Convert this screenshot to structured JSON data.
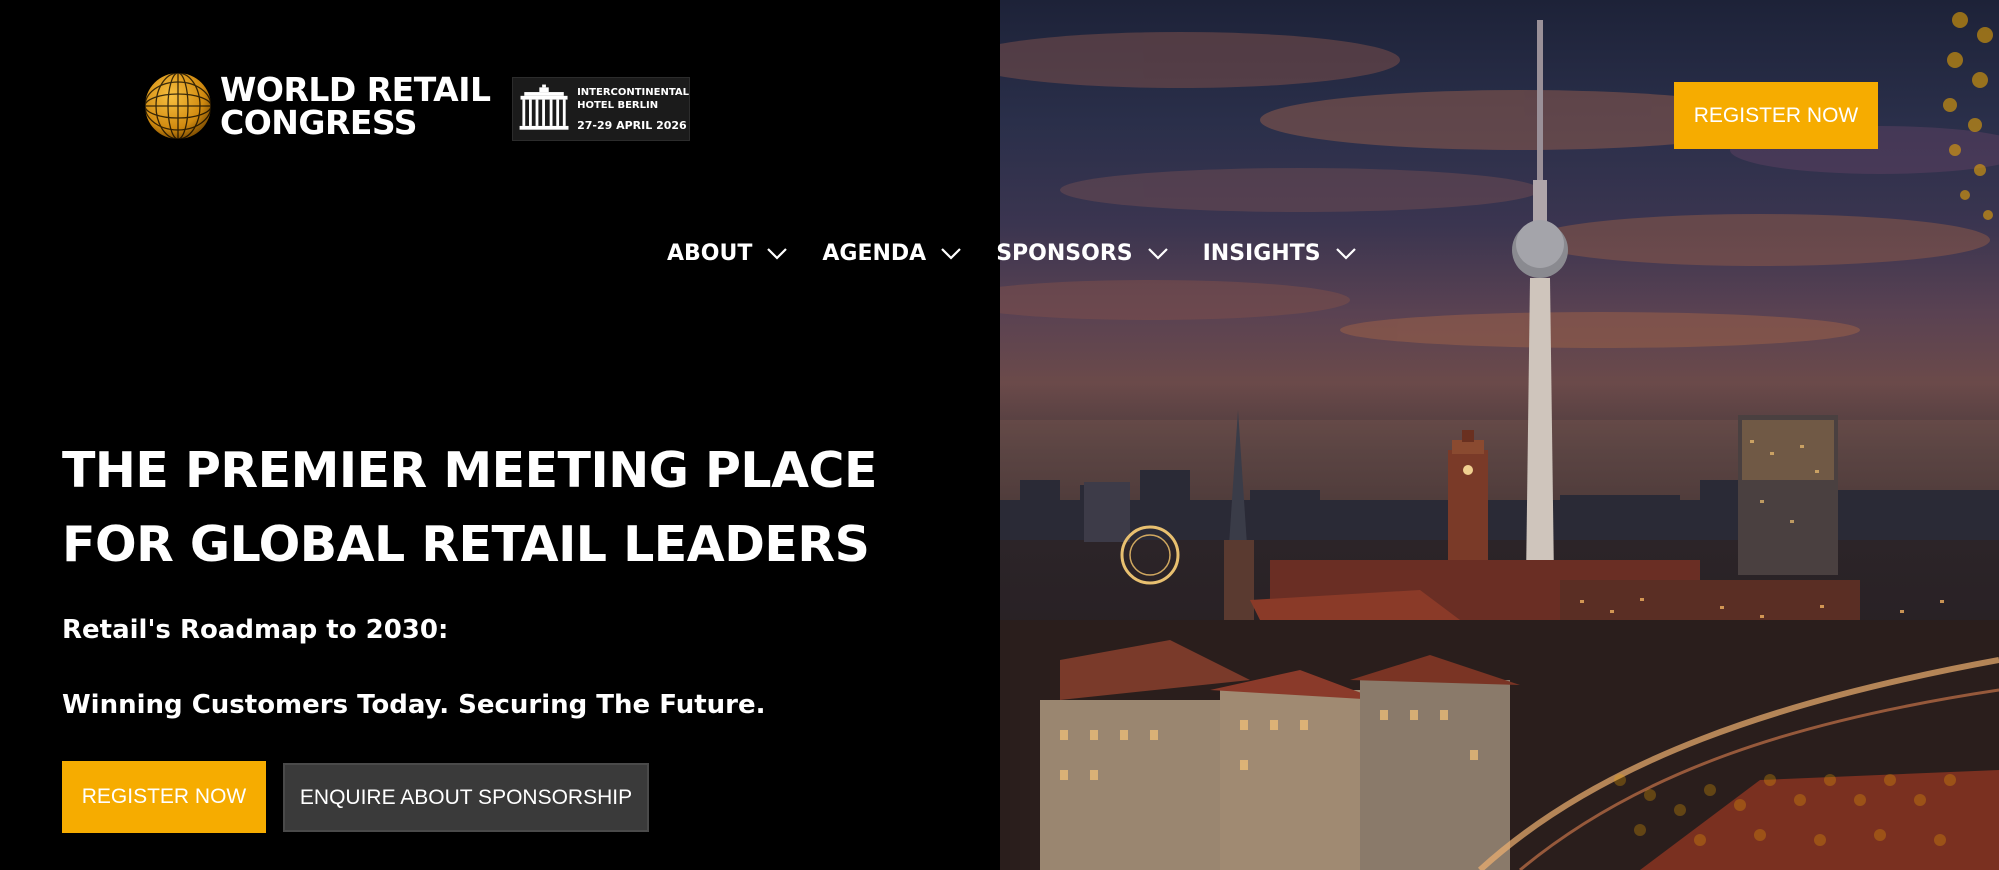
{
  "logo": {
    "line1": "WORLD RETAIL",
    "line2": "CONGRESS",
    "icon": "dotted-globe-icon"
  },
  "venue": {
    "line1": "INTERCONTINENTAL",
    "line2": "HOTEL BERLIN",
    "dates": "27-29 APRIL 2026",
    "icon": "brandenburg-gate-icon"
  },
  "nav": {
    "items": [
      {
        "label": "ABOUT"
      },
      {
        "label": "AGENDA"
      },
      {
        "label": "SPONSORS"
      },
      {
        "label": "INSIGHTS"
      }
    ]
  },
  "header": {
    "register_label": "REGISTER NOW"
  },
  "hero": {
    "title_line1": "THE PREMIER MEETING PLACE",
    "title_line2": "FOR GLOBAL RETAIL LEADERS",
    "subtitle_line1": "Retail's Roadmap to 2030:",
    "subtitle_line2": "Winning Customers Today. Securing The Future.",
    "register_label": "REGISTER NOW",
    "sponsorship_label": "ENQUIRE ABOUT SPONSORSHIP"
  },
  "colors": {
    "accent": "#f6ac00",
    "background": "#000000",
    "secondary_button": "#3a3a3a"
  }
}
